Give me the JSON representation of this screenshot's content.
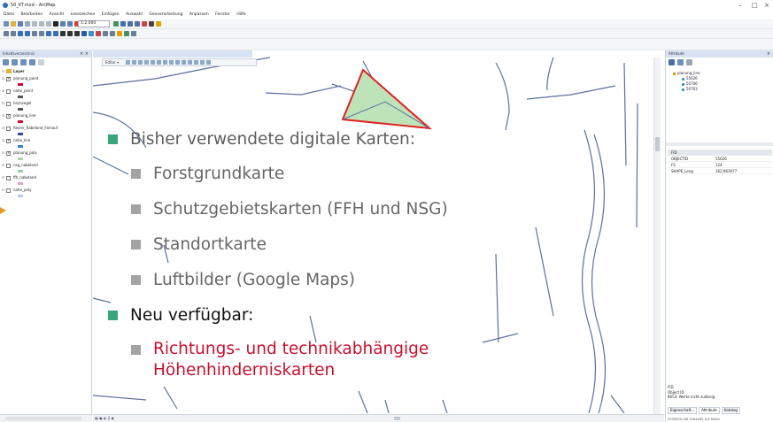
{
  "window": {
    "title": "50_KT.mxd - ArcMap",
    "minimize_label": "–",
    "maximize_label": "□",
    "close_label": "×"
  },
  "menu": [
    "Datei",
    "Bearbeiten",
    "Ansicht",
    "Lesezeichen",
    "Einfügen",
    "Auswahl",
    "Geoverarbeitung",
    "Anpassen",
    "Fenster",
    "Hilfe"
  ],
  "toolbar": {
    "scale_value": "1:2.000"
  },
  "toc": {
    "title": "Inhaltsverzeichnis",
    "close_label": "× ×",
    "root_layer": "Layer",
    "layers": [
      {
        "name": "planung_point",
        "checked": true,
        "symbol_color": "#c8102e"
      },
      {
        "name": "nahe_point",
        "checked": false,
        "symbol_color": "#555555"
      },
      {
        "name": "hochsegel",
        "checked": false,
        "symbol_color": "#555555"
      },
      {
        "name": "planung_line",
        "checked": true,
        "symbol_color": "#c8102e"
      },
      {
        "name": "Revier_Rabeland_Feinauf",
        "checked": false,
        "symbol_color": "#2d4f9e"
      },
      {
        "name": "nahe_line",
        "checked": true,
        "symbol_color": "#3a7fcf"
      },
      {
        "name": "planung_poly",
        "checked": true,
        "symbol_color": "#a3d99e"
      },
      {
        "name": "nsg_nabeland",
        "checked": false,
        "symbol_color": "#8fd3a8"
      },
      {
        "name": "ffh_nabeland",
        "checked": false,
        "symbol_color": "#e6a2c8"
      },
      {
        "name": "nahe_poly",
        "checked": false,
        "symbol_color": "#b8c9ef"
      }
    ]
  },
  "map": {
    "editor_label": "Editor ▾"
  },
  "slide": {
    "bullets": [
      {
        "level": 1,
        "text": "Bisher verwendete digitale Karten:"
      },
      {
        "level": 2,
        "text": "Forstgrundkarte"
      },
      {
        "level": 2,
        "text": "Schutzgebietskarten (FFH und NSG)"
      },
      {
        "level": 2,
        "text": "Standortkarte"
      },
      {
        "level": 2,
        "text": "Luftbilder (Google Maps)"
      },
      {
        "level": 1,
        "text": "Neu verfügbar:"
      },
      {
        "level": 2,
        "text_line1": "Richtungs- und technikabhängige",
        "text_line2": "Höhenhinderniskarten"
      }
    ],
    "colors": {
      "accent_green": "#3aa57a",
      "accent_red": "#c8102e",
      "bullet_grey": "#a3a3a3"
    }
  },
  "attributes": {
    "title": "Attribute",
    "layer": "planung_line",
    "features": [
      "55626",
      "50706",
      "50703"
    ],
    "table_header": "FID",
    "rows": [
      {
        "key": "OBJECTID",
        "value": "55626"
      },
      {
        "key": "FS",
        "value": "124"
      },
      {
        "key": "SHAPE_Leng",
        "value": "162,963977"
      }
    ],
    "fid_title": "FID",
    "fid_lines": [
      "Object ID",
      "8653: Werte nicht zulässig"
    ],
    "tabs": [
      "Eigenschaft...",
      "Attribute",
      "Katalog"
    ],
    "status": "5335678,108 5284485,105 Meter"
  }
}
